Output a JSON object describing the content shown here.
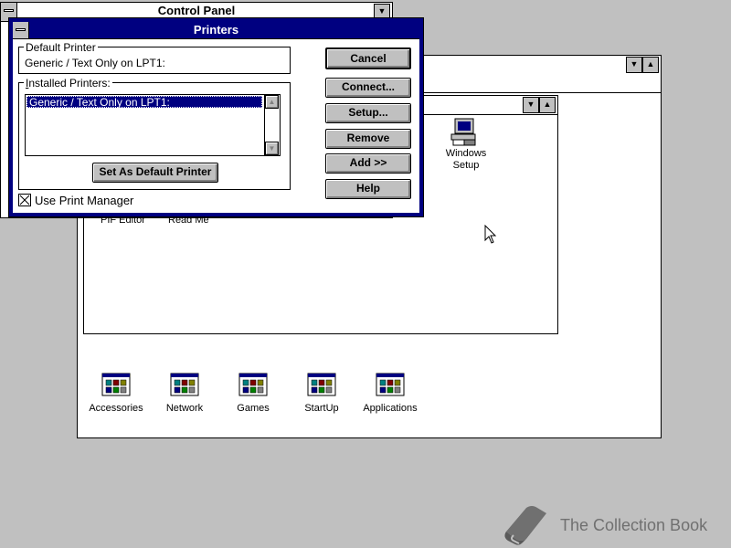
{
  "control_panel": {
    "title": "Control Panel"
  },
  "program_manager": {
    "group_icons": [
      {
        "label": "Accessories",
        "icon": "program-group-icon"
      },
      {
        "label": "Network",
        "icon": "program-group-icon"
      },
      {
        "label": "Games",
        "icon": "program-group-icon"
      },
      {
        "label": "StartUp",
        "icon": "program-group-icon"
      },
      {
        "label": "Applications",
        "icon": "program-group-icon"
      }
    ],
    "main_group": {
      "windows_setup_label_1": "Windows",
      "windows_setup_label_2": "Setup",
      "pif_editor_label": "PIF Editor",
      "readme_label": "Read Me"
    }
  },
  "printers_dialog": {
    "title": "Printers",
    "default_printer_label": "Default Printer",
    "default_printer_value": "Generic / Text Only on LPT1:",
    "installed_printers_label": "Installed Printers:",
    "installed_printers": [
      "Generic / Text Only on LPT1:"
    ],
    "set_default_button": "Set As Default Printer",
    "use_print_manager_label": "Use Print Manager",
    "use_print_manager_checked": true,
    "buttons": {
      "cancel": "Cancel",
      "connect": "Connect...",
      "setup": "Setup...",
      "remove": "Remove",
      "add": "Add >>",
      "help": "Help"
    }
  },
  "watermark": {
    "text": "The Collection Book",
    "icon": "book-icon"
  },
  "colors": {
    "desktop": "#c0c0c0",
    "active_title": "#000080",
    "selection": "#000080"
  }
}
